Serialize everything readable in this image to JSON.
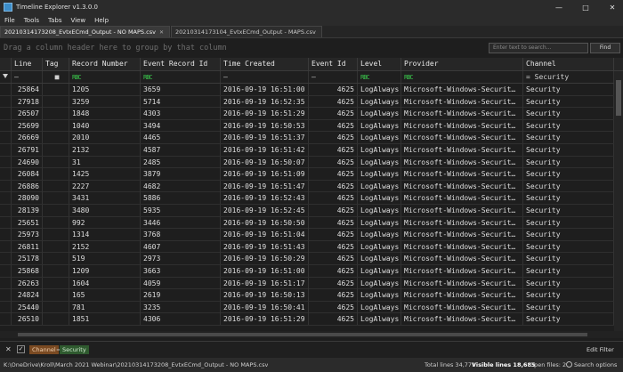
{
  "window": {
    "title": "Timeline Explorer v1.3.0.0"
  },
  "menu": [
    "File",
    "Tools",
    "Tabs",
    "View",
    "Help"
  ],
  "tabs": [
    {
      "label": "20210314173208_EvtxECmd_Output - NO MAPS.csv"
    },
    {
      "label": "20210314173104_EvtxECmd_Output - MAPS.csv"
    }
  ],
  "group_hint": "Drag a column header here to group by that column",
  "search": {
    "placeholder": "Enter text to search...",
    "find_label": "Find"
  },
  "columns": [
    "Line",
    "Tag",
    "Record Number",
    "Event Record Id",
    "Time Created",
    "Event Id",
    "Level",
    "Provider",
    "Channel"
  ],
  "filter_row": {
    "line": "—",
    "tag": "■",
    "record_number": "RBC",
    "event_record_id": "RBC",
    "time_created": "—",
    "event_id": "—",
    "level": "RBC",
    "provider": "RBC",
    "channel": "= Security"
  },
  "rows": [
    [
      "25864",
      "1205",
      "3659",
      "2016-09-19 16:51:00",
      "4625",
      "LogAlways",
      "Microsoft-Windows-Securit…",
      "Security"
    ],
    [
      "27918",
      "3259",
      "5714",
      "2016-09-19 16:52:35",
      "4625",
      "LogAlways",
      "Microsoft-Windows-Securit…",
      "Security"
    ],
    [
      "26507",
      "1848",
      "4303",
      "2016-09-19 16:51:29",
      "4625",
      "LogAlways",
      "Microsoft-Windows-Securit…",
      "Security"
    ],
    [
      "25699",
      "1040",
      "3494",
      "2016-09-19 16:50:53",
      "4625",
      "LogAlways",
      "Microsoft-Windows-Securit…",
      "Security"
    ],
    [
      "26669",
      "2010",
      "4465",
      "2016-09-19 16:51:37",
      "4625",
      "LogAlways",
      "Microsoft-Windows-Securit…",
      "Security"
    ],
    [
      "26791",
      "2132",
      "4587",
      "2016-09-19 16:51:42",
      "4625",
      "LogAlways",
      "Microsoft-Windows-Securit…",
      "Security"
    ],
    [
      "24690",
      "31",
      "2485",
      "2016-09-19 16:50:07",
      "4625",
      "LogAlways",
      "Microsoft-Windows-Securit…",
      "Security"
    ],
    [
      "26084",
      "1425",
      "3879",
      "2016-09-19 16:51:09",
      "4625",
      "LogAlways",
      "Microsoft-Windows-Securit…",
      "Security"
    ],
    [
      "26886",
      "2227",
      "4682",
      "2016-09-19 16:51:47",
      "4625",
      "LogAlways",
      "Microsoft-Windows-Securit…",
      "Security"
    ],
    [
      "28090",
      "3431",
      "5886",
      "2016-09-19 16:52:43",
      "4625",
      "LogAlways",
      "Microsoft-Windows-Securit…",
      "Security"
    ],
    [
      "28139",
      "3480",
      "5935",
      "2016-09-19 16:52:45",
      "4625",
      "LogAlways",
      "Microsoft-Windows-Securit…",
      "Security"
    ],
    [
      "25651",
      "992",
      "3446",
      "2016-09-19 16:50:50",
      "4625",
      "LogAlways",
      "Microsoft-Windows-Securit…",
      "Security"
    ],
    [
      "25973",
      "1314",
      "3768",
      "2016-09-19 16:51:04",
      "4625",
      "LogAlways",
      "Microsoft-Windows-Securit…",
      "Security"
    ],
    [
      "26811",
      "2152",
      "4607",
      "2016-09-19 16:51:43",
      "4625",
      "LogAlways",
      "Microsoft-Windows-Securit…",
      "Security"
    ],
    [
      "25178",
      "519",
      "2973",
      "2016-09-19 16:50:29",
      "4625",
      "LogAlways",
      "Microsoft-Windows-Securit…",
      "Security"
    ],
    [
      "25868",
      "1209",
      "3663",
      "2016-09-19 16:51:00",
      "4625",
      "LogAlways",
      "Microsoft-Windows-Securit…",
      "Security"
    ],
    [
      "26263",
      "1604",
      "4059",
      "2016-09-19 16:51:17",
      "4625",
      "LogAlways",
      "Microsoft-Windows-Securit…",
      "Security"
    ],
    [
      "24824",
      "165",
      "2619",
      "2016-09-19 16:50:13",
      "4625",
      "LogAlways",
      "Microsoft-Windows-Securit…",
      "Security"
    ],
    [
      "25440",
      "781",
      "3235",
      "2016-09-19 16:50:41",
      "4625",
      "LogAlways",
      "Microsoft-Windows-Securit…",
      "Security"
    ],
    [
      "26510",
      "1851",
      "4306",
      "2016-09-19 16:51:29",
      "4625",
      "LogAlways",
      "Microsoft-Windows-Securit…",
      "Security"
    ]
  ],
  "filter": {
    "field": "Channel",
    "op": "=",
    "value": "Security",
    "edit_label": "Edit Filter"
  },
  "status": {
    "path": "K:\\OneDrive\\Kroll\\March 2021 Webinar\\20210314173208_EvtxECmd_Output - NO MAPS.csv",
    "total_lines": "Total lines 34,771",
    "visible_lines": "Visible lines 18,685",
    "open_files": "Open files: 2",
    "search_options": "Search options"
  },
  "colors": {
    "bg": "#1e1e1e",
    "header": "#262626",
    "filter_field": "#7a4a22",
    "filter_value": "#2f5a2f",
    "rbc": "#39c24a"
  }
}
